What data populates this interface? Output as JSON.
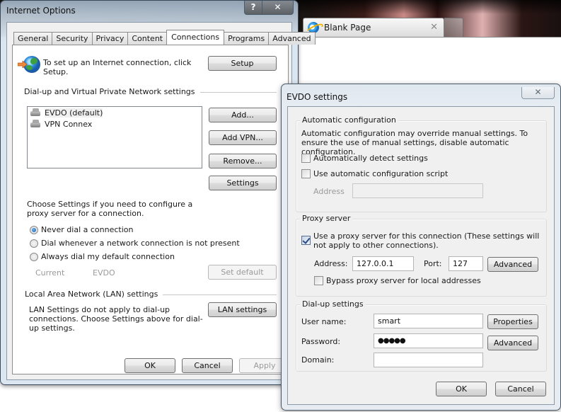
{
  "browser": {
    "tab_title": "Blank Page",
    "tab_close": "✕"
  },
  "internet_options": {
    "title": "Internet Options",
    "help_button": "?",
    "close_button": "✕",
    "tabs": [
      {
        "label": "General",
        "active": false
      },
      {
        "label": "Security",
        "active": false
      },
      {
        "label": "Privacy",
        "active": false
      },
      {
        "label": "Content",
        "active": false
      },
      {
        "label": "Connections",
        "active": true
      },
      {
        "label": "Programs",
        "active": false
      },
      {
        "label": "Advanced",
        "active": false
      }
    ],
    "setup_text": "To set up an Internet connection, click Setup.",
    "setup_button": "Setup",
    "dialup_section": "Dial-up and Virtual Private Network settings",
    "connections": [
      {
        "label": "EVDO (default)",
        "selected": true
      },
      {
        "label": "VPN Connex",
        "selected": false
      }
    ],
    "add_button": "Add...",
    "add_vpn_button": "Add VPN...",
    "remove_button": "Remove...",
    "proxy_text": "Choose Settings if you need to configure a proxy server for a connection.",
    "settings_button": "Settings",
    "dial_options": [
      {
        "label": "Never dial a connection",
        "checked": true
      },
      {
        "label": "Dial whenever a network connection is not present",
        "checked": false
      },
      {
        "label": "Always dial my default connection",
        "checked": false
      }
    ],
    "current_label": "Current",
    "current_value": "EVDO",
    "set_default_button": "Set default",
    "lan_section": "Local Area Network (LAN) settings",
    "lan_text": "LAN Settings do not apply to dial-up connections. Choose Settings above for dial-up settings.",
    "lan_button": "LAN settings",
    "ok_button": "OK",
    "cancel_button": "Cancel",
    "apply_button": "Apply"
  },
  "evdo_settings": {
    "title": "EVDO settings",
    "close_button": "✕",
    "auto_config": {
      "legend": "Automatic configuration",
      "description": "Automatic configuration may override manual settings.  To ensure the use of manual settings, disable automatic configuration.",
      "auto_detect_label": "Automatically detect settings",
      "auto_detect_checked": false,
      "auto_script_label": "Use automatic configuration script",
      "auto_script_checked": false,
      "address_label": "Address",
      "address_value": ""
    },
    "proxy": {
      "legend": "Proxy server",
      "use_proxy_label": "Use a proxy server for this connection (These settings will not apply to other connections).",
      "use_proxy_checked": true,
      "address_label": "Address:",
      "address_value": "127.0.0.1",
      "port_label": "Port:",
      "port_value": "127",
      "advanced_button": "Advanced",
      "bypass_label": "Bypass proxy server for local addresses",
      "bypass_checked": false
    },
    "dialup": {
      "legend": "Dial-up settings",
      "username_label": "User name:",
      "username_value": "smart",
      "password_label": "Password:",
      "password_value": "●●●●●",
      "domain_label": "Domain:",
      "domain_value": "",
      "properties_button": "Properties",
      "advanced_button": "Advanced"
    },
    "ok_button": "OK",
    "cancel_button": "Cancel"
  }
}
